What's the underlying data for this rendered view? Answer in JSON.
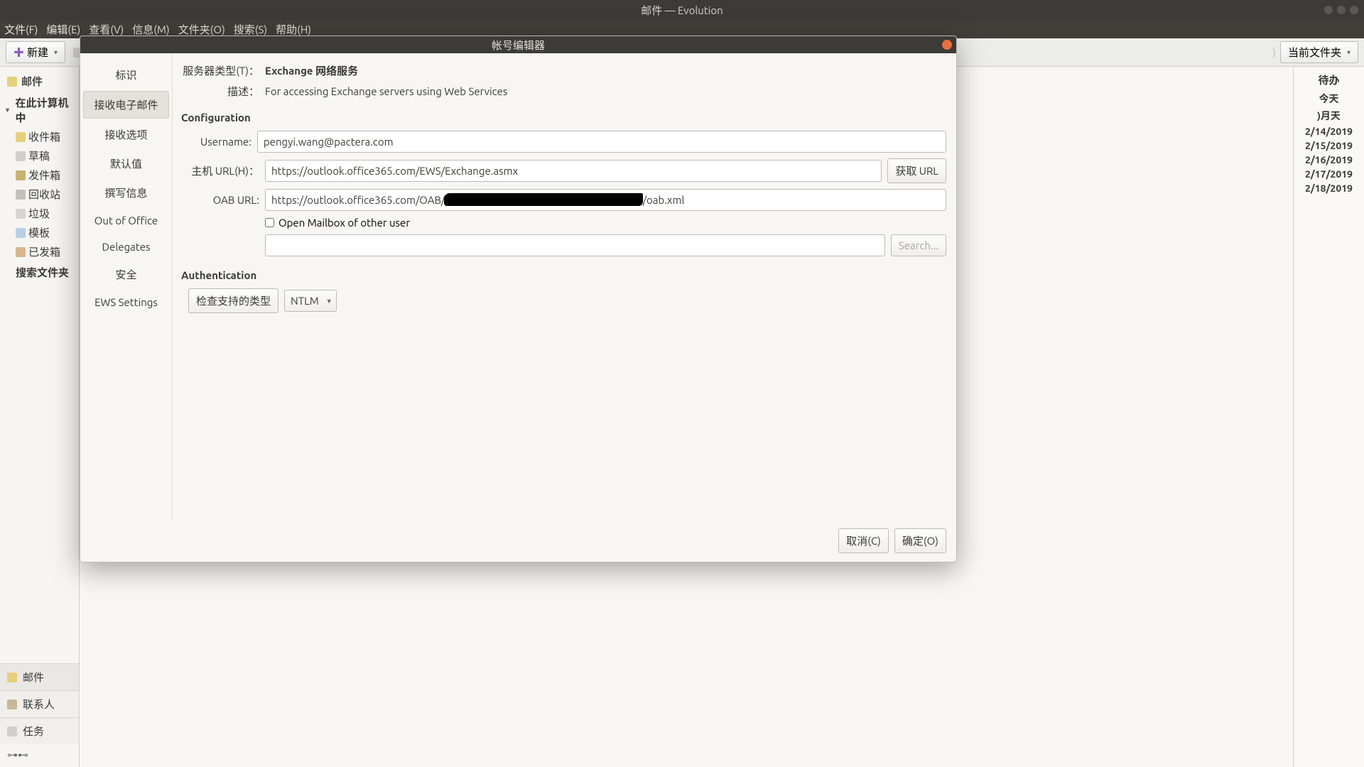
{
  "titlebar": {
    "title": "邮件 — Evolution"
  },
  "menubar": {
    "file": "文件(F)",
    "edit": "编辑(E)",
    "view": "查看(V)",
    "message": "信息(M)",
    "folder": "文件夹(O)",
    "search": "搜索(S)",
    "help": "帮助(H)"
  },
  "toolbar": {
    "new": "新建",
    "current_folder": "当前文件夹"
  },
  "left": {
    "header": "邮件",
    "root": "在此计算机中",
    "inbox": "收件箱",
    "drafts": "草稿",
    "outbox": "发件箱",
    "recycle": "回收站",
    "junk": "垃圾",
    "templates": "模板",
    "sent": "已发箱",
    "search_folders": "搜索文件夹",
    "cat_mail": "邮件",
    "cat_contacts": "联系人",
    "cat_tasks": "任务",
    "switcher_glyph": "⊶⊷"
  },
  "right": {
    "todo": "待办",
    "today_head": "今天",
    "head2": ")月天",
    "d1": "2/14/2019",
    "d2": "2/15/2019",
    "d3": "2/16/2019",
    "d4": "2/17/2019",
    "d5": "2/18/2019"
  },
  "dialog": {
    "title": "帐号编辑器",
    "nav": {
      "identity": "标识",
      "receiving": "接收电子邮件",
      "recv_opts": "接收选项",
      "defaults": "默认值",
      "composing": "撰写信息",
      "ooo": "Out of Office",
      "delegates": "Delegates",
      "security": "安全",
      "ews": "EWS Settings"
    },
    "labels": {
      "server_type": "服务器类型(T)：",
      "description": "描述：",
      "configuration": "Configuration",
      "username": "Username:",
      "host_url": "主机 URL(H)：",
      "oab_url": "OAB URL:",
      "fetch_url": "获取 URL",
      "open_other": "Open Mailbox of other user",
      "search": "Search...",
      "authentication": "Authentication",
      "check_types": "检查支持的类型",
      "cancel": "取消(C)",
      "ok": "确定(O)"
    },
    "values": {
      "server_type": "Exchange 网络服务",
      "description": "For accessing Exchange servers using Web Services",
      "username": "pengyi.wang@pactera.com",
      "host_url": "https://outlook.office365.com/EWS/Exchange.asmx",
      "oab_url_prefix": "https://outlook.office365.com/OAB/",
      "oab_url_suffix": "/oab.xml",
      "other_user": "",
      "auth_type": "NTLM"
    }
  }
}
